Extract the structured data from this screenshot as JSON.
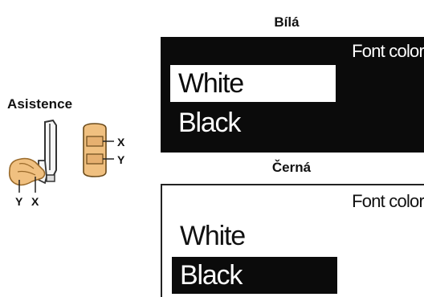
{
  "assist": {
    "title": "Asistence",
    "labels": {
      "x": "X",
      "y": "Y"
    }
  },
  "panels": [
    {
      "caption": "Bílá",
      "header": "Font color",
      "options": [
        "White",
        "Black"
      ],
      "selected": "White",
      "background": "#0b0b0b"
    },
    {
      "caption": "Černá",
      "header": "Font color",
      "options": [
        "White",
        "Black"
      ],
      "selected": "Black",
      "background": "#ffffff"
    }
  ],
  "colors": {
    "skin": "#f0c080",
    "skin_outline": "#9a6a2a",
    "device_fill": "#f7f7f7",
    "device_outline": "#333333"
  }
}
